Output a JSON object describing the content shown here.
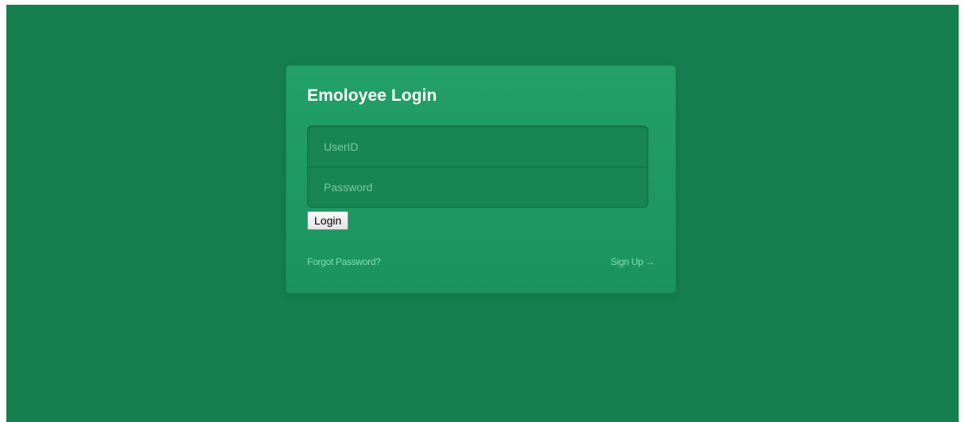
{
  "login_form": {
    "title": "Emoloyee Login",
    "userid_placeholder": "UserID",
    "password_placeholder": "Password",
    "login_label": "Login",
    "forgot_password_label": "Forgot Password?",
    "sign_up_label": "Sign Up →"
  },
  "colors": {
    "background": "#167f4f",
    "card": "#1e9a62",
    "link": "#7fe0ad"
  }
}
